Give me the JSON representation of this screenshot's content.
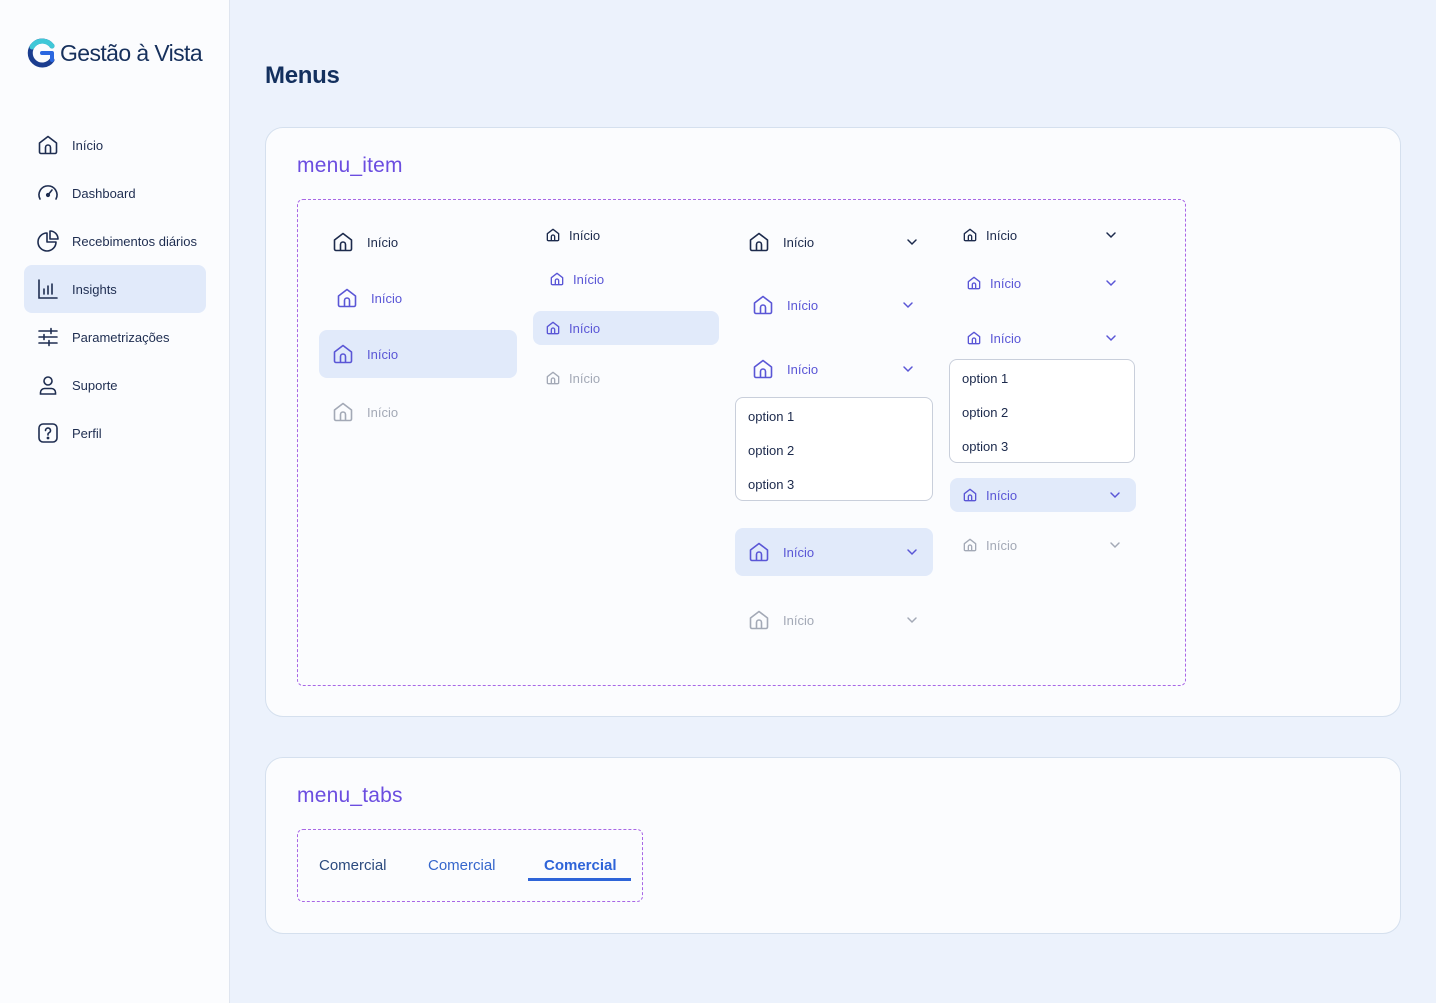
{
  "app": {
    "logo_text": "Gestão à Vista"
  },
  "sidebar": {
    "items": [
      {
        "label": "Início",
        "icon": "home-icon"
      },
      {
        "label": "Dashboard",
        "icon": "gauge-icon"
      },
      {
        "label": "Recebimentos diários",
        "icon": "pie-chart-icon"
      },
      {
        "label": "Insights",
        "icon": "bar-chart-icon",
        "active": true
      },
      {
        "label": "Parametrizações",
        "icon": "sliders-icon"
      },
      {
        "label": "Suporte",
        "icon": "user-icon"
      },
      {
        "label": "Perfil",
        "icon": "help-icon"
      }
    ]
  },
  "page": {
    "title": "Menus"
  },
  "menu_item_section": {
    "title": "menu_item",
    "item_label": "Início",
    "options": [
      "option 1",
      "option 2",
      "option 3"
    ]
  },
  "menu_tabs_section": {
    "title": "menu_tabs",
    "tabs": [
      "Comercial",
      "Comercial",
      "Comercial"
    ]
  },
  "colors": {
    "accent": "#6b4de0",
    "selected_bg": "#e1eafa",
    "tab_active": "#2e64d8",
    "dashed_border": "#a866e6"
  }
}
